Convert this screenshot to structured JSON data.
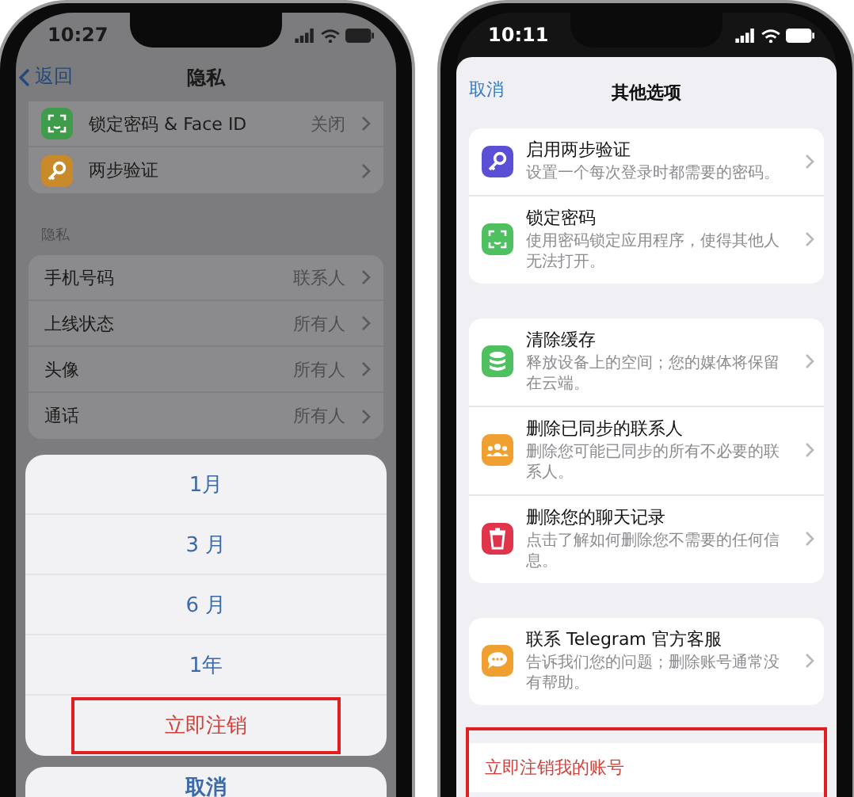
{
  "left_phone": {
    "status_bar": {
      "time": "10:27"
    },
    "nav": {
      "back": "返回",
      "title": "隐私"
    },
    "security_rows": [
      {
        "label": "锁定密码 & Face ID",
        "value": "关闭",
        "kind": "face",
        "color": "#3f9c4b"
      },
      {
        "label": "两步验证",
        "kind": "key",
        "color": "#c98a2c"
      }
    ],
    "section_header": "隐私",
    "privacy_rows": [
      {
        "label": "手机号码",
        "value": "联系人"
      },
      {
        "label": "上线状态",
        "value": "所有人"
      },
      {
        "label": "头像",
        "value": "所有人"
      },
      {
        "label": "通话",
        "value": "所有人"
      }
    ],
    "action_sheet": {
      "options": [
        {
          "label": "1月",
          "kind": "normal",
          "highlighted": false
        },
        {
          "label": "3 月",
          "kind": "normal",
          "highlighted": false
        },
        {
          "label": "6 月",
          "kind": "normal",
          "highlighted": false
        },
        {
          "label": "1年",
          "kind": "normal",
          "highlighted": false
        },
        {
          "label": "立即注销",
          "kind": "destructive",
          "highlighted": true
        }
      ],
      "cancel": "取消"
    }
  },
  "right_phone": {
    "status_bar": {
      "time": "10:11"
    },
    "nav": {
      "cancel": "取消",
      "title": "其他选项"
    },
    "groups": [
      {
        "items": [
          {
            "title": "启用两步验证",
            "subtitle": "设置一个每次登录时都需要的密码。",
            "kind": "key",
            "color": "#5b4fd6"
          },
          {
            "title": "锁定密码",
            "subtitle": "使用密码锁定应用程序，使得其他人无法打开。",
            "kind": "face",
            "color": "#4fc05f"
          }
        ]
      },
      {
        "items": [
          {
            "title": "清除缓存",
            "subtitle": "释放设备上的空间；您的媒体将保留在云端。",
            "kind": "database",
            "color": "#4fc05f"
          },
          {
            "title": "删除已同步的联系人",
            "subtitle": "删除您可能已同步的所有不必要的联系人。",
            "kind": "people",
            "color": "#f0a030"
          },
          {
            "title": "删除您的聊天记录",
            "subtitle": "点击了解如何删除您不需要的任何信息。",
            "kind": "trash",
            "color": "#e0344a"
          }
        ]
      },
      {
        "items": [
          {
            "title": "联系 Telegram 官方客服",
            "subtitle": "告诉我们您的问题；删除账号通常没有帮助。",
            "kind": "chat",
            "color": "#f0a030"
          }
        ]
      }
    ],
    "delete_account": {
      "label": "立即注销我的账号",
      "highlighted": true
    }
  }
}
